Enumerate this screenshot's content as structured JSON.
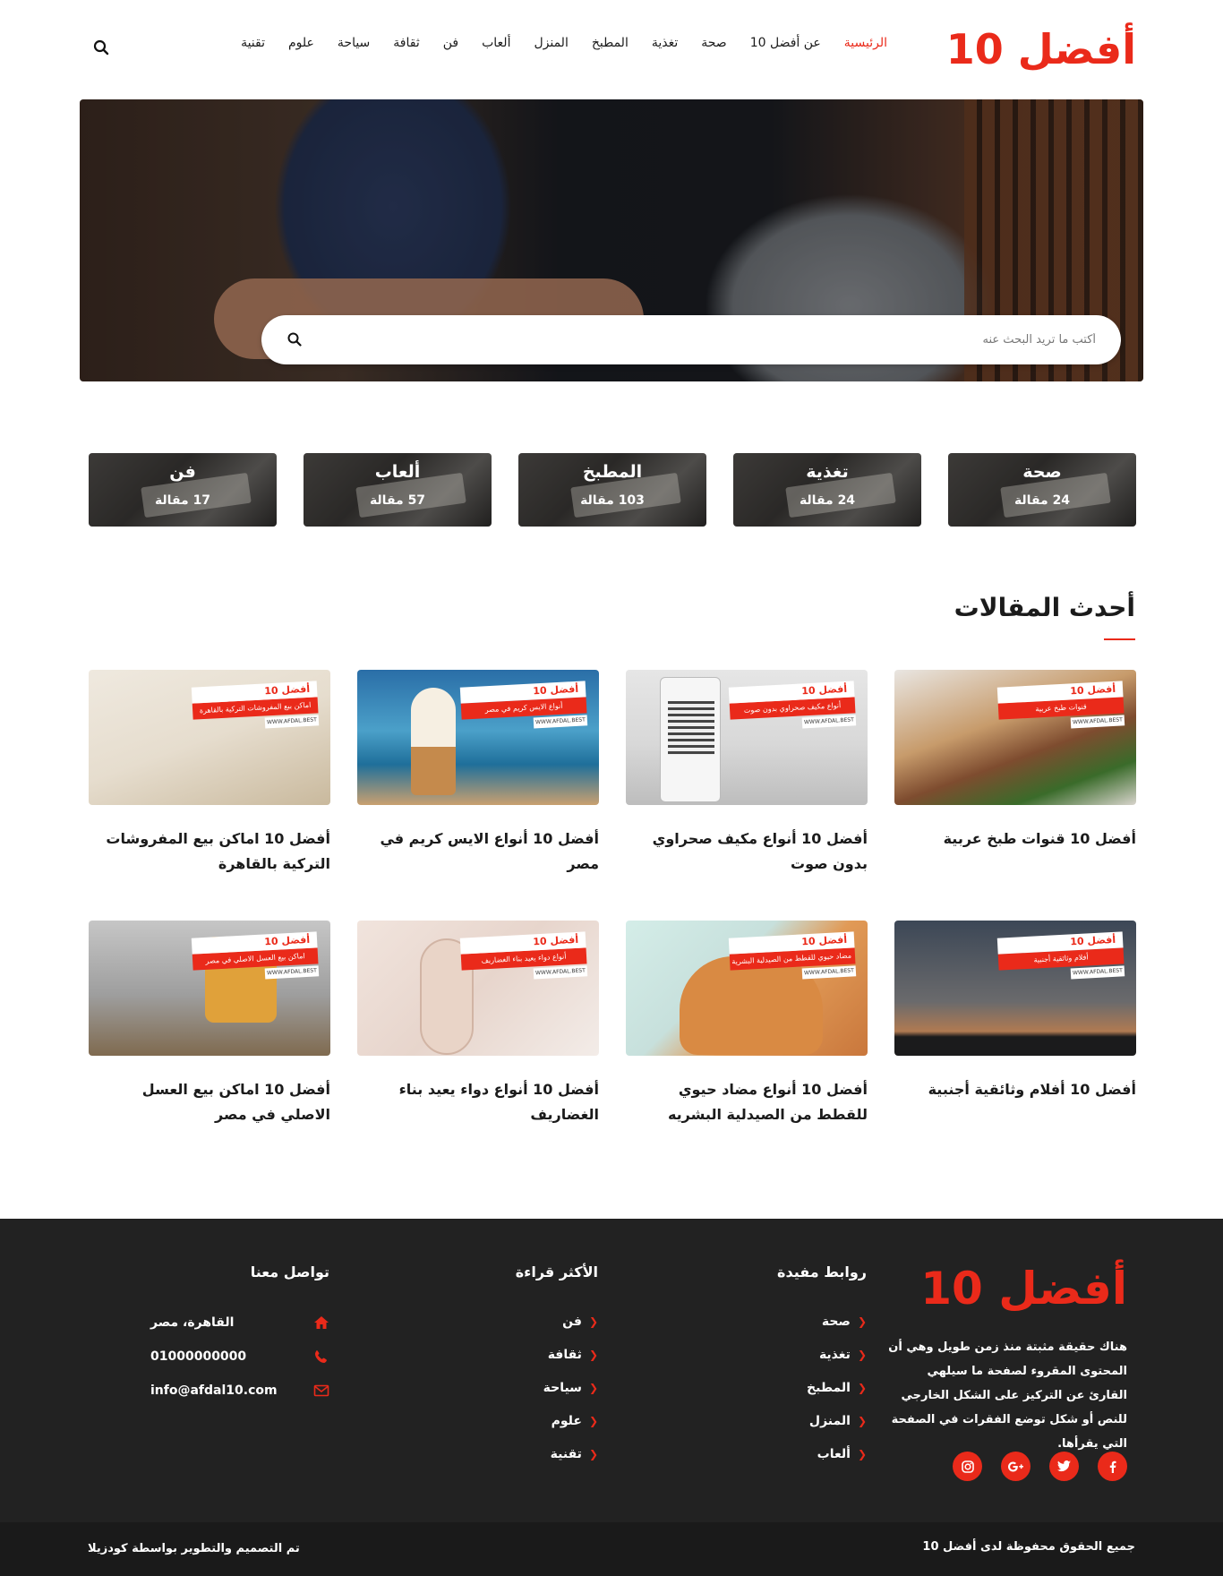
{
  "brand": {
    "logo": "أفضل 10",
    "accent": "#ea2a1a"
  },
  "nav": {
    "items": [
      "الرئيسية",
      "عن أفضل 10",
      "صحة",
      "تغذية",
      "المطبخ",
      "المنزل",
      "ألعاب",
      "فن",
      "ثقافة",
      "سياحة",
      "علوم",
      "تقنية"
    ],
    "active_index": 0
  },
  "hero": {
    "search_placeholder": "أكتب ما تريد البحث عنه"
  },
  "categories": [
    {
      "name": "صحة",
      "count": "24 مقالة"
    },
    {
      "name": "تغذية",
      "count": "24 مقالة"
    },
    {
      "name": "المطبخ",
      "count": "103 مقالة"
    },
    {
      "name": "ألعاب",
      "count": "57 مقالة"
    },
    {
      "name": "فن",
      "count": "17 مقالة"
    }
  ],
  "latest": {
    "title": "أحدث المقالات",
    "articles": [
      {
        "title": "أفضل 10 قنوات طبخ عربية",
        "tag_brand": "أفضل 10",
        "tag_text": "قنوات طبخ عربية",
        "tag_url": "WWW.AFDAL.BEST"
      },
      {
        "title": "أفضل 10 أنواع مكيف صحراوي بدون صوت",
        "tag_brand": "أفضل 10",
        "tag_text": "أنواع مكيف صحراوي بدون صوت",
        "tag_url": "WWW.AFDAL.BEST"
      },
      {
        "title": "أفضل 10 أنواع الايس كريم في مصر",
        "tag_brand": "أفضل 10",
        "tag_text": "أنواع الايس كريم في مصر",
        "tag_url": "WWW.AFDAL.BEST"
      },
      {
        "title": "أفضل 10 اماكن بيع المفروشات التركية بالقاهرة",
        "tag_brand": "أفضل 10",
        "tag_text": "اماكن بيع المفروشات التركية بالقاهرة",
        "tag_url": "WWW.AFDAL.BEST"
      },
      {
        "title": "أفضل 10 أفلام وثائقية أجنبية",
        "tag_brand": "أفضل 10",
        "tag_text": "أفلام وثائقية أجنبية",
        "tag_url": "WWW.AFDAL.BEST"
      },
      {
        "title": "أفضل 10 أنواع مضاد حيوي للقطط من الصيدلية البشريه",
        "tag_brand": "أفضل 10",
        "tag_text": "مضاد حيوي للقطط من الصيدلية البشرية",
        "tag_url": "WWW.AFDAL.BEST"
      },
      {
        "title": "أفضل 10 أنواع دواء يعيد بناء الغضاريف",
        "tag_brand": "أفضل 10",
        "tag_text": "أنواع دواء يعيد بناء الغضاريف",
        "tag_url": "WWW.AFDAL.BEST"
      },
      {
        "title": "أفضل 10 اماكن بيع العسل الاصلي في مصر",
        "tag_brand": "أفضل 10",
        "tag_text": "اماكن بيع العسل الاصلي في مصر",
        "tag_url": "WWW.AFDAL.BEST"
      }
    ]
  },
  "footer": {
    "logo": "أفضل 10",
    "about": "هناك حقيقة مثبتة منذ زمن طويل وهي أن المحتوى المقروء لصفحة ما سيلهي القارئ عن التركيز على الشكل الخارجي للنص أو شكل توضع الفقرات في الصفحة التي يقرأها.",
    "social": [
      "facebook-icon",
      "twitter-icon",
      "google-plus-icon",
      "instagram-icon"
    ],
    "links": {
      "title": "روابط مفيدة",
      "items": [
        "صحة",
        "تغذية",
        "المطبخ",
        "المنزل",
        "ألعاب"
      ]
    },
    "most_read": {
      "title": "الأكثر قراءة",
      "items": [
        "فن",
        "ثقافة",
        "سياحة",
        "علوم",
        "تقنية"
      ]
    },
    "contact": {
      "title": "تواصل معنا",
      "address": "القاهرة، مصر",
      "phone": "01000000000",
      "email": "info@afdal10.com"
    },
    "copyright": "جميع الحقوق محفوظة لدى أفضل 10",
    "credit": "تم التصميم والتطوير بواسطة كودزيلا"
  }
}
